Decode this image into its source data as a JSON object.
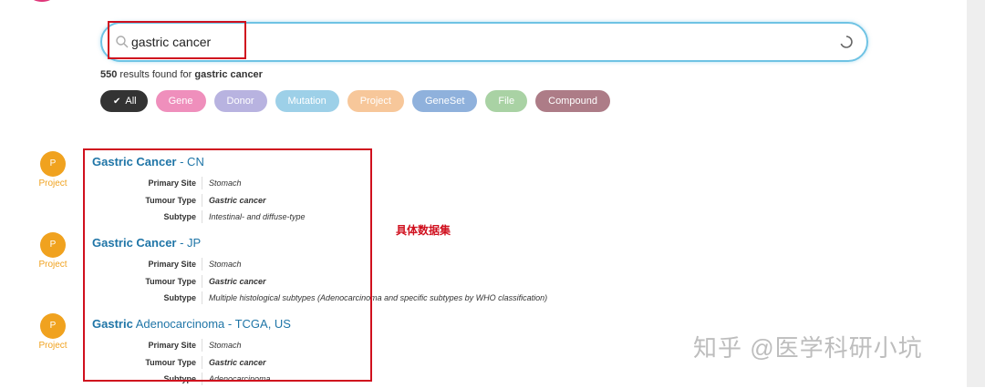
{
  "search": {
    "query": "gastric cancer"
  },
  "summary": {
    "count": "550",
    "text": "results found for",
    "term": "gastric cancer"
  },
  "filters": [
    {
      "label": "All",
      "color": "#333333"
    },
    {
      "label": "Gene",
      "color": "#ef8fbc"
    },
    {
      "label": "Donor",
      "color": "#b8b3e0"
    },
    {
      "label": "Mutation",
      "color": "#9dd0e8"
    },
    {
      "label": "Project",
      "color": "#f7c79a"
    },
    {
      "label": "GeneSet",
      "color": "#8fb1dc"
    },
    {
      "label": "File",
      "color": "#a9d2a4"
    },
    {
      "label": "Compound",
      "color": "#ad7c87"
    }
  ],
  "results": [
    {
      "badge": "P",
      "type_label": "Project",
      "title_bold": "Gastric Cancer",
      "title_rest": " - CN",
      "fields": [
        {
          "key": "Primary Site",
          "value": "Stomach",
          "bold": false
        },
        {
          "key": "Tumour Type",
          "value": "Gastric cancer",
          "bold": true
        },
        {
          "key": "Subtype",
          "value": "Intestinal- and diffuse-type",
          "bold": false
        }
      ]
    },
    {
      "badge": "P",
      "type_label": "Project",
      "title_bold": "Gastric Cancer",
      "title_rest": " - JP",
      "fields": [
        {
          "key": "Primary Site",
          "value": "Stomach",
          "bold": false
        },
        {
          "key": "Tumour Type",
          "value": "Gastric cancer",
          "bold": true
        },
        {
          "key": "Subtype",
          "value": "Multiple histological subtypes (Adenocarcinoma and specific subtypes by WHO classification)",
          "bold": false
        }
      ]
    },
    {
      "badge": "P",
      "type_label": "Project",
      "title_bold": "Gastric",
      "title_rest": " Adenocarcinoma - TCGA, US",
      "fields": [
        {
          "key": "Primary Site",
          "value": "Stomach",
          "bold": false
        },
        {
          "key": "Tumour Type",
          "value": "Gastric cancer",
          "bold": true
        },
        {
          "key": "Subtype",
          "value": "Adenocarcinoma",
          "bold": false
        }
      ]
    }
  ],
  "annotation": "具体数据集",
  "watermark": "知乎 @医学科研小坑",
  "colors": {
    "accent": "#1f75a7",
    "highlight": "#d0101e",
    "project": "#f0a21f",
    "search_border": "#6fc3e4"
  }
}
